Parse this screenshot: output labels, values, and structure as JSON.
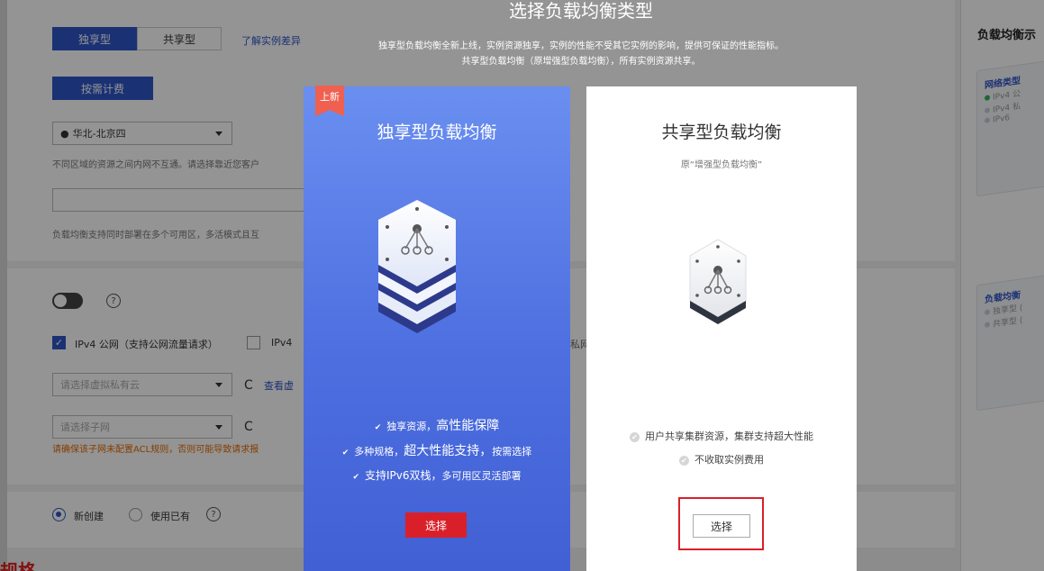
{
  "background": {
    "tab_dedicated": "独享型",
    "tab_shared": "共享型",
    "compare_link": "了解实例差异",
    "billing_button": "按需计费",
    "region_value": "华北-北京四",
    "region_hint": "不同区域的资源之间内网不互通。请选择靠近您客户",
    "az_hint": "负载均衡支持同时部署在多个可用区，多活模式且互",
    "ipv4_public_label": "IPv4 公网（支持公网流量请求）",
    "ipv4_private_label_partial": "IPv4 ",
    "private_network_partial": "私网",
    "vpc_placeholder": "请选择虚拟私有云",
    "vpc_link": "查看虚",
    "subnet_placeholder": "请选择子网",
    "subnet_warning": "请确保该子网未配置ACL规则，否则可能导致请求报",
    "radio_new": "新创建",
    "radio_existing": "使用已有",
    "section_title_partial": "规格"
  },
  "right_panel": {
    "title": "负载均衡示",
    "card1_title": "网络类型",
    "card1_rows": [
      "IPv4 公",
      "IPv4 私",
      "IPv6"
    ],
    "card2_title": "负载均衡",
    "card2_rows": [
      "独享型 (",
      "共享型 ("
    ]
  },
  "modal": {
    "title": "选择负载均衡类型",
    "desc_line1": "独享型负载均衡全新上线，实例资源独享，实例的性能不受其它实例的影响，提供可保证的性能指标。",
    "desc_line2": "共享型负载均衡（原增强型负载均衡），所有实例资源共享。",
    "dedicated": {
      "badge": "上新",
      "title": "独享型负载均衡",
      "features": [
        {
          "plain_before": "独享资源，",
          "big": "高性能保障",
          "plain_after": ""
        },
        {
          "plain_before": "多种规格，",
          "big": "超大性能支持，",
          "plain_after": "按需选择"
        },
        {
          "plain_before": "",
          "big": "支持IPv6双栈，",
          "plain_after": "多可用区灵活部署"
        }
      ],
      "select_button": "选择"
    },
    "shared": {
      "title": "共享型负载均衡",
      "subtitle": "原“增强型负载均衡”",
      "features": [
        "用户共享集群资源，集群支持超大性能",
        "不收取实例费用"
      ],
      "select_button": "选择"
    }
  },
  "colors": {
    "primary_blue": "#2d55c8",
    "select_red": "#d9202a",
    "badge_red": "#f06050",
    "highlight_border": "#d9202a"
  }
}
